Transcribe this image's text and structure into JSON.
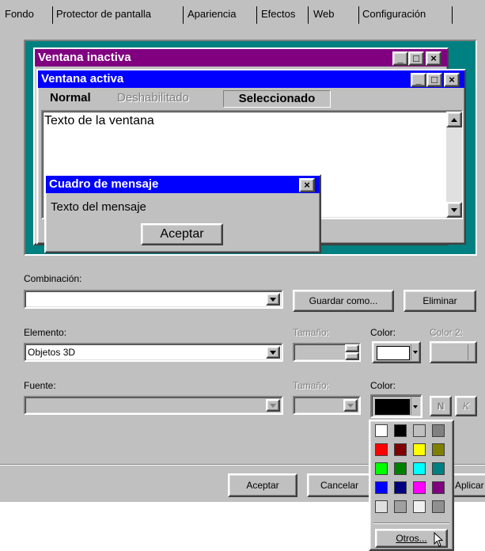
{
  "tabs": [
    "Fondo",
    "Protector de pantalla",
    "Apariencia",
    "Efectos",
    "Web",
    "Configuración"
  ],
  "preview": {
    "inactive_title": "Ventana inactiva",
    "active_title": "Ventana activa",
    "menu": [
      "Normal",
      "Deshabilitado",
      "Seleccionado"
    ],
    "window_text": "Texto de la ventana",
    "msgbox_title": "Cuadro de mensaje",
    "msgbox_text": "Texto del mensaje",
    "msgbox_ok": "Aceptar",
    "caption_buttons": [
      "_",
      "□",
      "×"
    ]
  },
  "scheme": {
    "label": "Combinación:",
    "value": "",
    "save_as": "Guardar como...",
    "delete": "Eliminar"
  },
  "item": {
    "label": "Elemento:",
    "value": "Objetos 3D",
    "size_label": "Tamaño:",
    "color_label": "Color:",
    "color2_label": "Color 2:"
  },
  "font": {
    "label": "Fuente:",
    "value": "",
    "size_label": "Tamaño:",
    "color_label": "Color:",
    "bold": "N",
    "italic": "K"
  },
  "colors": {
    "item_color": "#ffffff",
    "font_color": "#000000",
    "palette": [
      "#ffffff",
      "#000000",
      "#c0c0c0",
      "#808080",
      "#ff0000",
      "#800000",
      "#ffff00",
      "#808000",
      "#00ff00",
      "#008000",
      "#00ffff",
      "#008080",
      "#0000ff",
      "#000080",
      "#ff00ff",
      "#800080",
      "#e0e0e0",
      "#a0a0a0",
      "#f0f0f0",
      "#909090"
    ]
  },
  "palette_other": "Otros...",
  "footer": {
    "ok": "Aceptar",
    "cancel": "Cancelar",
    "apply": "Aplicar"
  }
}
